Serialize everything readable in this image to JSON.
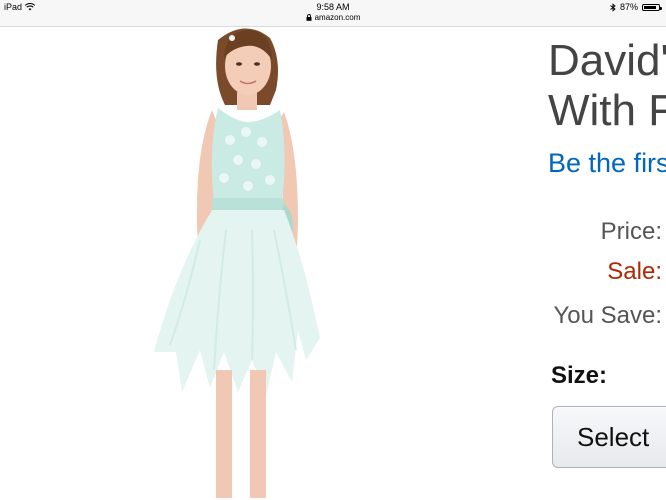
{
  "status_bar": {
    "device": "iPad",
    "time": "9:58 AM",
    "url": "amazon.com",
    "battery": "87%",
    "battery_level": 0.87
  },
  "product": {
    "title_line1": "David'",
    "title_line2": "With F",
    "review_link": "Be the firs",
    "price_label": "Price:",
    "sale_label": "Sale:",
    "you_save_label": "You Save:",
    "size_label": "Size:",
    "select_button": "Select"
  },
  "colors": {
    "link": "#0066c0",
    "sale": "#b12704",
    "dress": "#e3f4f1"
  },
  "icons": [
    "wifi-icon",
    "lock-icon",
    "bluetooth-icon",
    "battery-icon"
  ]
}
